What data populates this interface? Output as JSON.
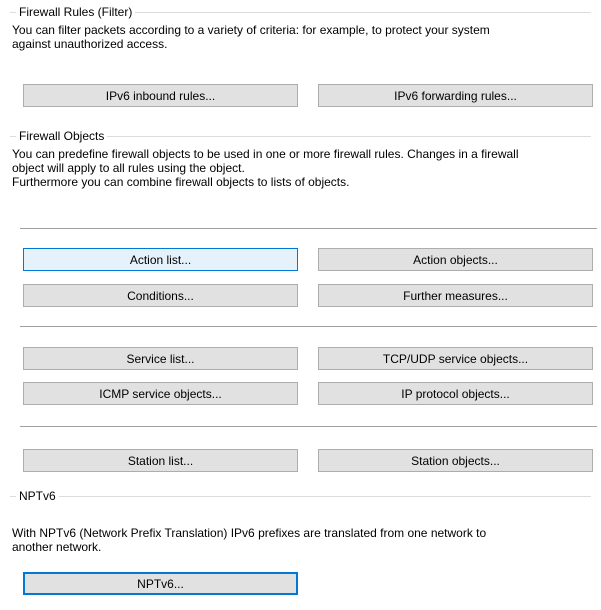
{
  "firewall_rules": {
    "title": "Firewall Rules (Filter)",
    "description": [
      "You can filter packets according to a variety of criteria: for example, to protect your system",
      "against unauthorized access."
    ],
    "buttons": {
      "ipv6_inbound": "IPv6 inbound rules...",
      "ipv6_forwarding": "IPv6 forwarding rules..."
    }
  },
  "firewall_objects": {
    "title": "Firewall Objects",
    "description": [
      "You can predefine firewall objects to be used in one or more firewall rules. Changes in a firewall",
      "object will apply to all rules using the object.",
      "Furthermore you can combine firewall objects to lists of objects."
    ],
    "buttons": {
      "action_list": "Action list...",
      "action_objects": "Action objects...",
      "conditions": "Conditions...",
      "further_measures": "Further measures...",
      "service_list": "Service list...",
      "tcp_udp_service_objects": "TCP/UDP service objects...",
      "icmp_service_objects": "ICMP service objects...",
      "ip_protocol_objects": "IP protocol objects...",
      "station_list": "Station list...",
      "station_objects": "Station objects..."
    }
  },
  "nptv6": {
    "title": "NPTv6",
    "description": [
      "With NPTv6 (Network Prefix Translation) IPv6 prefixes are translated from one network to",
      "another network."
    ],
    "buttons": {
      "nptv6": "NPTv6..."
    }
  },
  "colors": {
    "focus_border": "#0078d7",
    "focus_fill": "#e5f1fb",
    "button_fill": "#e1e1e1",
    "button_border": "#adadad"
  }
}
